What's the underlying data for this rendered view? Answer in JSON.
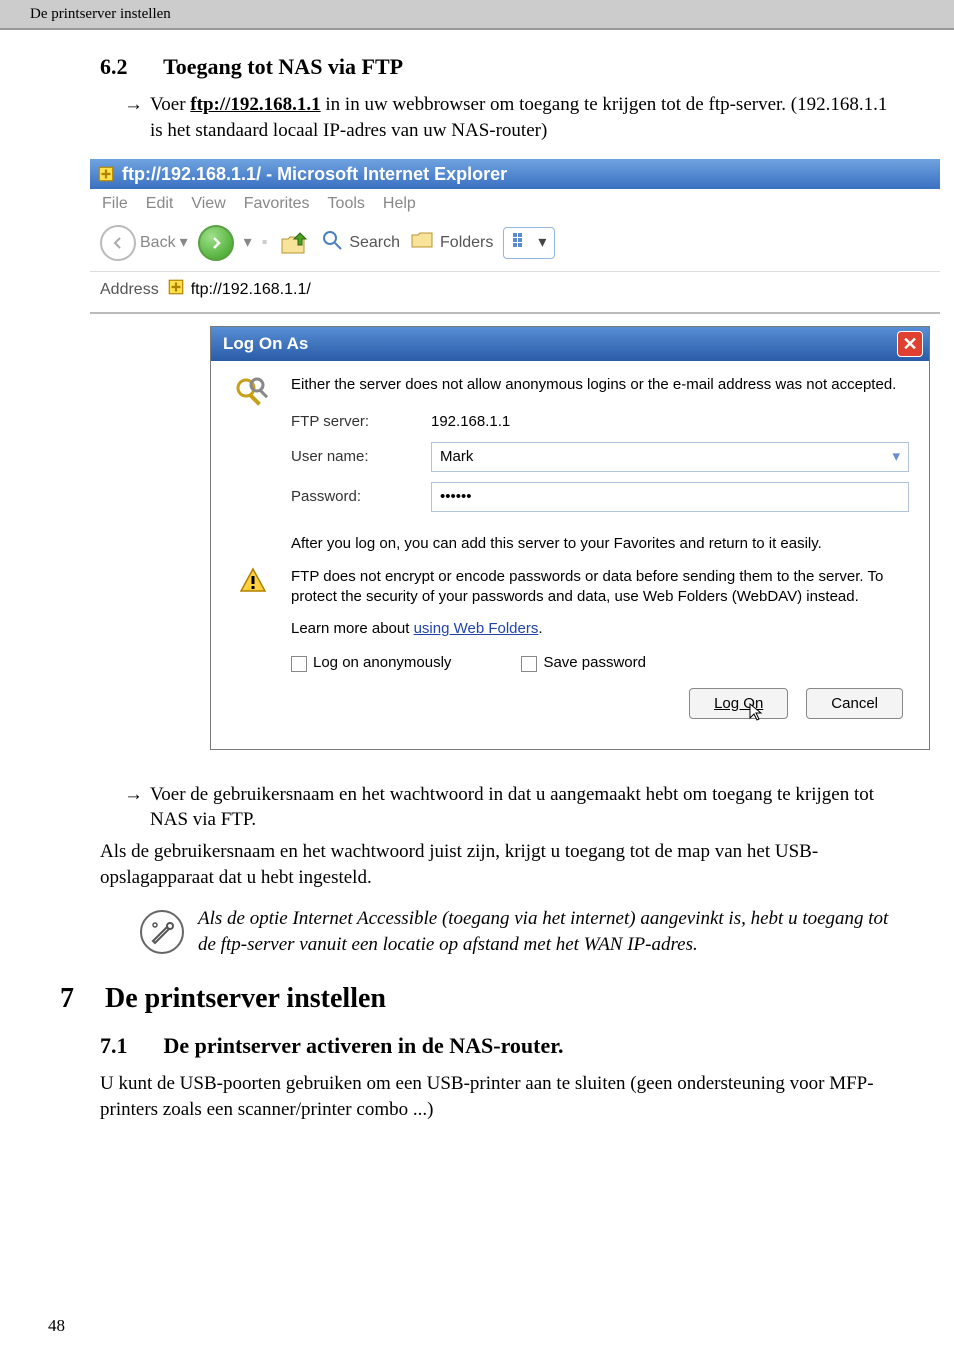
{
  "header": {
    "running_title": "De printserver instellen"
  },
  "section_6_2": {
    "number": "6.2",
    "title": "Toegang tot NAS via FTP",
    "bullet1_prefix": "Voer ",
    "bullet1_link": "ftp://192.168.1.1",
    "bullet1_rest": " in in uw webbrowser om toegang te krijgen tot de ftp-server. (192.168.1.1 is het standaard locaal IP-adres van uw NAS-router)",
    "bullet2": "Voer de gebruikersnaam en het wachtwoord in dat u aangemaakt hebt om toegang te krijgen tot NAS via FTP."
  },
  "screenshot": {
    "ie_title": "ftp://192.168.1.1/ - Microsoft Internet Explorer",
    "menu": {
      "file": "File",
      "edit": "Edit",
      "view": "View",
      "favorites": "Favorites",
      "tools": "Tools",
      "help": "Help"
    },
    "toolbar": {
      "back": "Back",
      "search": "Search",
      "folders": "Folders"
    },
    "address_label": "Address",
    "address_value": "ftp://192.168.1.1/",
    "dialog": {
      "title": "Log On As",
      "msg1": "Either the server does not allow anonymous logins or the e-mail address was not accepted.",
      "ftp_server_label": "FTP server:",
      "ftp_server_value": "192.168.1.1",
      "user_label": "User name:",
      "user_value": "Mark",
      "pass_label": "Password:",
      "pass_value": "••••••",
      "msg2": "After you log on, you can add this server to your Favorites and return to it easily.",
      "warn": "FTP does not encrypt or encode passwords or data before sending them to the server.  To protect the security of your passwords and data, use Web Folders (WebDAV) instead.",
      "learn_prefix": "Learn more about ",
      "learn_link": "using Web Folders",
      "chk_anon": "Log on anonymously",
      "chk_save": "Save password",
      "btn_logon": "Log On",
      "btn_cancel": "Cancel"
    }
  },
  "para_after": "Als de gebruikersnaam en het wachtwoord juist zijn, krijgt u toegang tot de map van het USB-opslagapparaat dat u hebt ingesteld.",
  "note": "Als de optie Internet Accessible (toegang via het internet) aangevinkt is, hebt u toegang tot de ftp-server vanuit een locatie op afstand met het WAN IP-adres.",
  "section_7": {
    "number": "7",
    "title": "De printserver instellen"
  },
  "section_7_1": {
    "number": "7.1",
    "title": "De printserver activeren in de NAS-router.",
    "body": "U kunt de USB-poorten gebruiken om een USB-printer aan te sluiten (geen ondersteuning voor MFP-printers zoals een scanner/printer combo ...)"
  },
  "page_number": "48"
}
